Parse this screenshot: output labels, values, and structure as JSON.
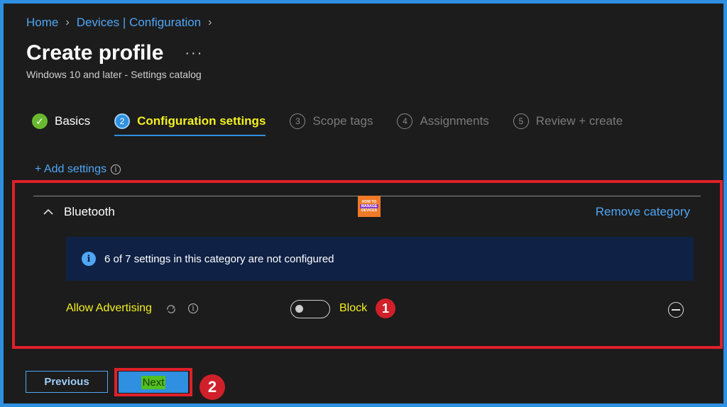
{
  "breadcrumb": [
    "Home",
    "Devices | Configuration"
  ],
  "header": {
    "title": "Create profile",
    "more": "···",
    "subtitle": "Windows 10 and later - Settings catalog"
  },
  "steps": [
    {
      "number": "✓",
      "label": "Basics",
      "state": "done"
    },
    {
      "number": "2",
      "label": "Configuration settings",
      "state": "active"
    },
    {
      "number": "3",
      "label": "Scope tags",
      "state": "pending"
    },
    {
      "number": "4",
      "label": "Assignments",
      "state": "pending"
    },
    {
      "number": "5",
      "label": "Review + create",
      "state": "pending"
    }
  ],
  "add_settings": "+ Add settings",
  "category": {
    "name": "Bluetooth",
    "remove_label": "Remove category",
    "info_text": "6 of 7 settings in this category are not configured"
  },
  "logo": {
    "top": "HOW TO",
    "mid": "MANAGE",
    "bottom": "DEVICES"
  },
  "setting": {
    "name": "Allow Advertising",
    "toggle_on": false,
    "toggle_label": "Block"
  },
  "annotations": {
    "badge1": "1",
    "badge2": "2"
  },
  "footer": {
    "previous": "Previous",
    "next": "Next"
  },
  "colors": {
    "accent": "#2f8fe0",
    "highlight": "#f3f020",
    "callout": "#e0202a",
    "success": "#6ab830"
  }
}
